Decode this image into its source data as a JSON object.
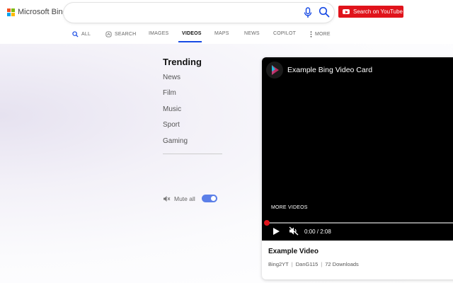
{
  "header": {
    "brand": "Microsoft Bing",
    "search": {
      "value": "",
      "placeholder": ""
    },
    "youtube_button": "Search on YouTube"
  },
  "tabs": [
    {
      "label": "ALL",
      "icon": "search-icon"
    },
    {
      "label": "SEARCH",
      "icon": "copilot-icon"
    },
    {
      "label": "IMAGES"
    },
    {
      "label": "VIDEOS",
      "active": true
    },
    {
      "label": "MAPS"
    },
    {
      "label": "NEWS"
    },
    {
      "label": "COPILOT"
    },
    {
      "label": "MORE",
      "icon": "more-vertical-icon"
    }
  ],
  "trending": {
    "title": "Trending",
    "items": [
      "News",
      "Film",
      "Music",
      "Sport",
      "Gaming"
    ]
  },
  "mute": {
    "label": "Mute all",
    "enabled": true
  },
  "video_card": {
    "title": "Example Bing Video Card",
    "more_videos": "MORE VIDEOS",
    "time": "0:00 / 2:08",
    "progress": 0,
    "video_title": "Example Video",
    "meta": [
      "Bing2YT",
      "DanG115",
      "72 Downloads"
    ]
  },
  "colors": {
    "accent": "#174ae4",
    "youtube_red": "#e0131b",
    "toggle": "#5b7fe8"
  }
}
